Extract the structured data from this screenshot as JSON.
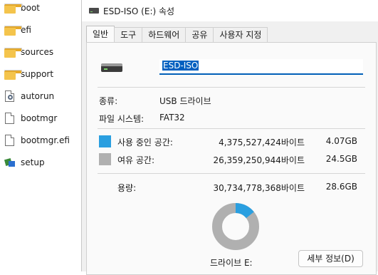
{
  "file_list": [
    {
      "name": "boot",
      "type": "folder"
    },
    {
      "name": "efi",
      "type": "folder"
    },
    {
      "name": "sources",
      "type": "folder"
    },
    {
      "name": "support",
      "type": "folder"
    },
    {
      "name": "autorun",
      "type": "config-file"
    },
    {
      "name": "bootmgr",
      "type": "file"
    },
    {
      "name": "bootmgr.efi",
      "type": "file"
    },
    {
      "name": "setup",
      "type": "installer"
    }
  ],
  "dialog": {
    "title": "ESD-ISO (E:) 속성",
    "tabs": [
      "일반",
      "도구",
      "하드웨어",
      "공유",
      "사용자 지정"
    ],
    "active_tab": "일반",
    "volume_name": "ESD-ISO",
    "type_label": "종류:",
    "type_value": "USB 드라이브",
    "fs_label": "파일 시스템:",
    "fs_value": "FAT32",
    "used_label": "사용 중인 공간:",
    "used_bytes": "4,375,527,424바이트",
    "used_size": "4.07GB",
    "free_label": "여유 공간:",
    "free_bytes": "26,359,250,944바이트",
    "free_size": "24.5GB",
    "capacity_label": "용량:",
    "capacity_bytes": "30,734,778,368바이트",
    "capacity_size": "28.6GB",
    "drive_label": "드라이브 E:",
    "details_button": "세부 정보(D)",
    "used_fraction": 0.1424,
    "colors": {
      "used": "#2a9fe0",
      "free": "#b0b0b0",
      "accent": "#005fb8"
    }
  }
}
